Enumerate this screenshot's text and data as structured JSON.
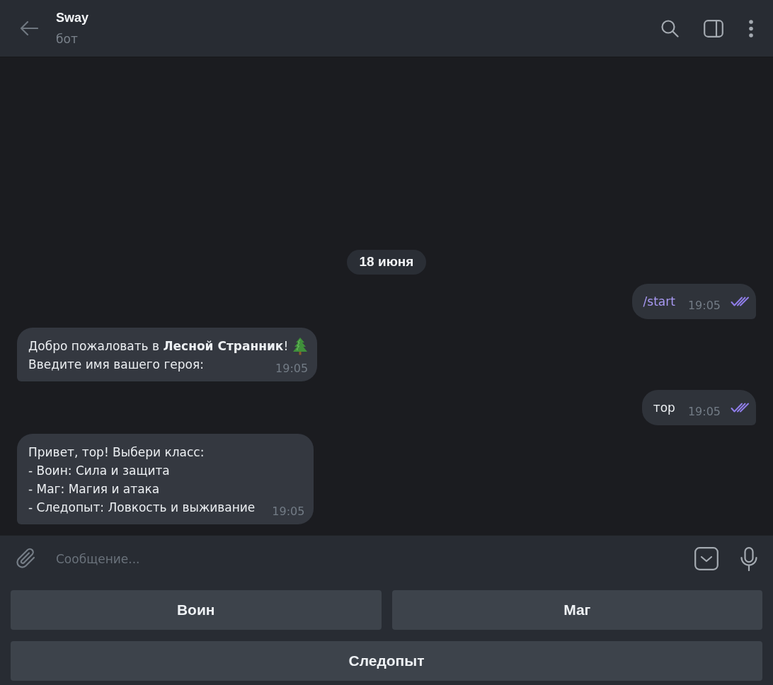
{
  "header": {
    "title": "Sway",
    "subtitle": "бот"
  },
  "date_badge": "18 июня",
  "messages": [
    {
      "kind": "outgoing",
      "lines": [
        {
          "text": "/start",
          "command": true,
          "emoji": false
        }
      ],
      "time": "19:05",
      "read": true
    },
    {
      "kind": "incoming",
      "lines": [
        {
          "text": "Добро пожаловать в **Лесной Странник**!",
          "command": false,
          "emoji": true
        },
        {
          "text": "Введите имя вашего героя:",
          "command": false,
          "emoji": false
        }
      ],
      "time": "19:05"
    },
    {
      "kind": "outgoing",
      "lines": [
        {
          "text": "тор",
          "command": false,
          "emoji": false
        }
      ],
      "time": "19:05",
      "read": true
    },
    {
      "kind": "incoming",
      "lines": [
        {
          "text": "Привет, тор! Выбери класс:",
          "command": false,
          "emoji": false
        },
        {
          "text": "- Воин: Сила и защита",
          "command": false,
          "emoji": false
        },
        {
          "text": "- Маг: Магия и атака",
          "command": false,
          "emoji": false
        },
        {
          "text": "- Следопыт: Ловкость и выживание",
          "command": false,
          "emoji": false
        }
      ],
      "time": "19:05"
    }
  ],
  "composer": {
    "placeholder": "Сообщение..."
  },
  "keyboard": [
    [
      {
        "label": "Воин"
      },
      {
        "label": "Маг"
      }
    ],
    [
      {
        "label": "Следопыт"
      }
    ]
  ]
}
